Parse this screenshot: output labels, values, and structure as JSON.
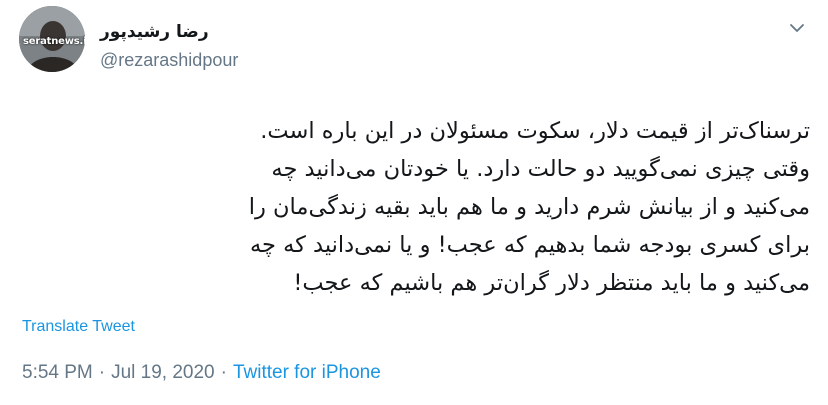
{
  "author": {
    "display_name": "رضا رشیدپور",
    "handle": "@rezarashidpour",
    "avatar_watermark": "seratnews.ir"
  },
  "tweet": {
    "lines": [
      "ترسناک‌تر از قیمت دلار، سکوت مسئولان در این باره است.",
      "وقتی چیزی نمی‌گویید دو حالت دارد. یا خودتان می‌دانید چه",
      "می‌کنید و از بیانش شرم دارید و ما هم باید بقیه زندگی‌مان را",
      "برای کسری بودجه شما بدهیم که عجب! و یا نمی‌دانید که چه",
      "می‌کنید و ما باید منتظر دلار گران‌تر هم باشیم که عجب!"
    ],
    "translate_label": "Translate Tweet",
    "time": "5:54 PM",
    "date": "Jul 19, 2020",
    "separator": "·",
    "source": "Twitter for iPhone"
  },
  "icons": {
    "avatar": "profile-photo",
    "more": "chevron-down-icon"
  },
  "colors": {
    "text": "#14171a",
    "secondary": "#657786",
    "link": "#1b95e0",
    "background": "#ffffff"
  }
}
